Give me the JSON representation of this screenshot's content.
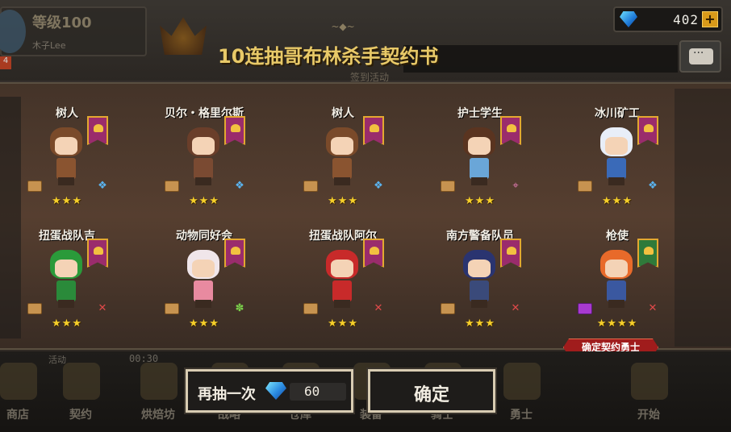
{
  "player": {
    "level": "等级100",
    "name": "木子Lee",
    "level_badge": "4"
  },
  "gems": {
    "count": "402",
    "plus_label": "+"
  },
  "header": {
    "ornament": "~◆~",
    "event": "签到活动"
  },
  "title": "10连抽哥布林杀手契约书",
  "heroes": [
    {
      "name": "树人",
      "stars": "★★★",
      "type_icon": "wing-icon",
      "banner": "purple"
    },
    {
      "name": "贝尔・格里尔斯",
      "stars": "★★★",
      "type_icon": "wing-icon",
      "banner": "purple"
    },
    {
      "name": "树人",
      "stars": "★★★",
      "type_icon": "wing-icon",
      "banner": "purple"
    },
    {
      "name": "护士学生",
      "stars": "★★★",
      "type_icon": "target-icon",
      "banner": "purple"
    },
    {
      "name": "冰川矿工",
      "stars": "★★★",
      "type_icon": "wing-icon",
      "banner": "purple"
    },
    {
      "name": "扭蛋战队吉",
      "stars": "★★★",
      "type_icon": "sword-icon",
      "banner": "purple"
    },
    {
      "name": "动物同好会",
      "stars": "★★★",
      "type_icon": "leaf-icon",
      "banner": "purple"
    },
    {
      "name": "扭蛋战队阿尔",
      "stars": "★★★",
      "type_icon": "sword-icon",
      "banner": "purple"
    },
    {
      "name": "南方警备队员",
      "stars": "★★★",
      "type_icon": "sword-icon",
      "banner": "purple"
    },
    {
      "name": "枪使",
      "stars": "★★★★",
      "type_icon": "sword-icon",
      "banner": "green"
    }
  ],
  "confirm_tag": "确定契约勇士",
  "nav": [
    {
      "label": "商店"
    },
    {
      "label": "契约"
    },
    {
      "label": "烘焙坊"
    },
    {
      "label": "战略"
    },
    {
      "label": "仓库"
    },
    {
      "label": "装备"
    },
    {
      "label": "骑士"
    },
    {
      "label": "勇士"
    },
    {
      "label": "开始"
    }
  ],
  "nav_extras": {
    "activity": "活动",
    "timer": "00:30"
  },
  "actions": {
    "again_label": "再抽一次",
    "again_cost": "60",
    "confirm_label": "确定"
  },
  "colors": {
    "title": "#e8c968",
    "star": "#f6cf2a",
    "banner_purple": "#9a2c6c",
    "confirm_tag": "#a01c1c"
  }
}
